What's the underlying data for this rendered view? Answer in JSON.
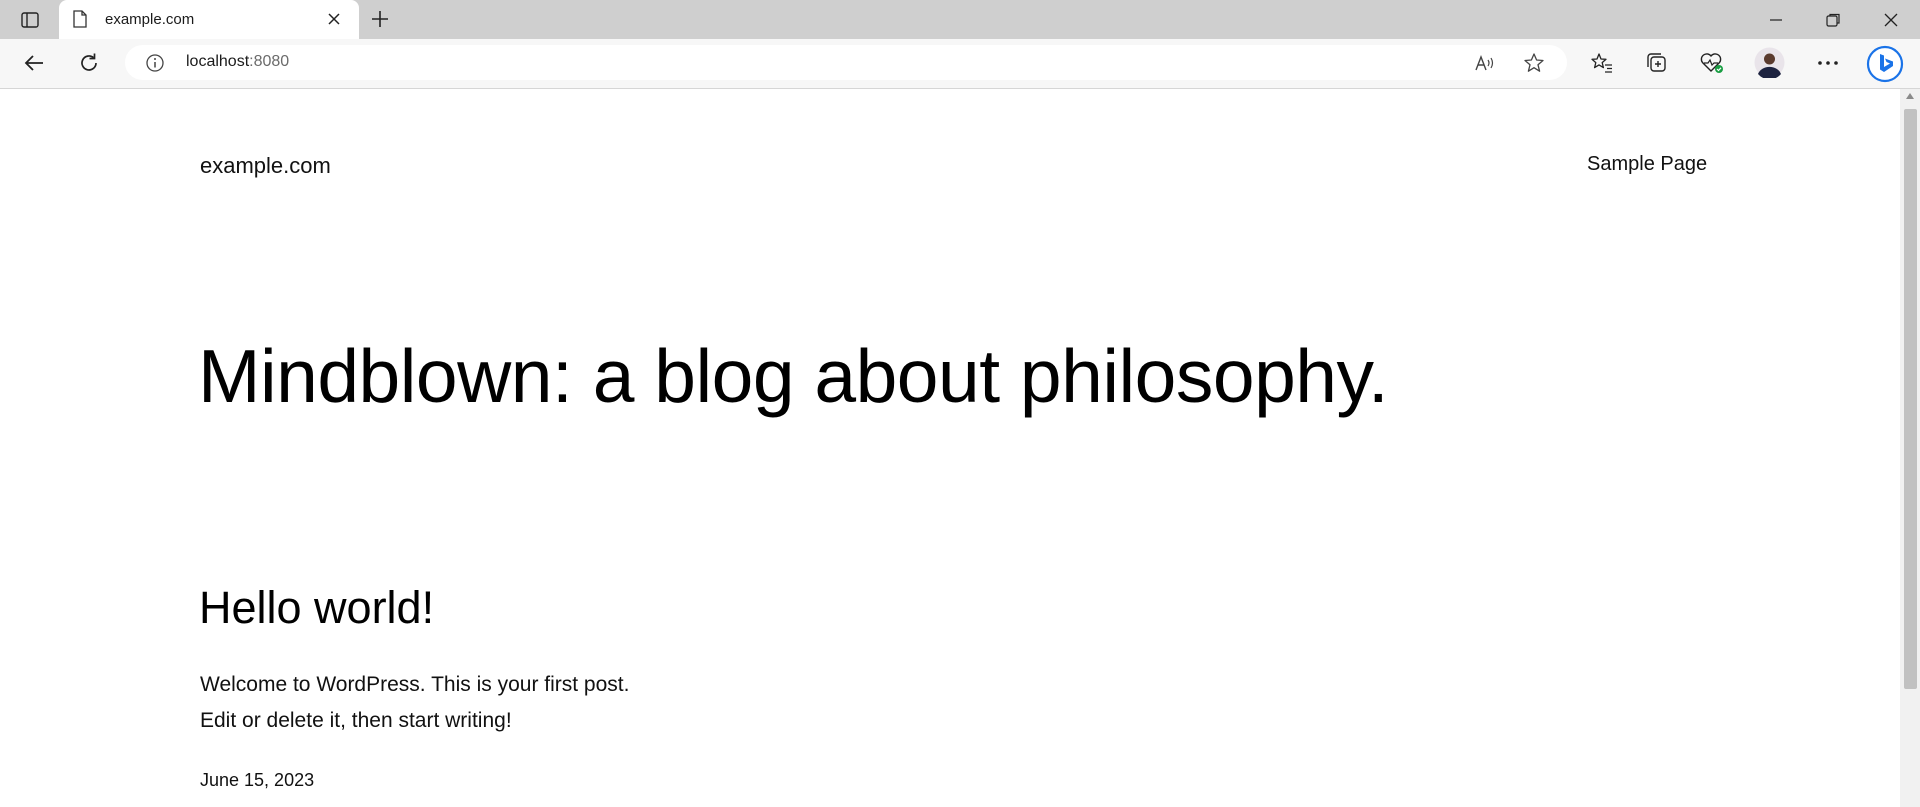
{
  "browser": {
    "tab": {
      "title": "example.com"
    },
    "address": {
      "host": "localhost",
      "port": ":8080"
    }
  },
  "icons": {
    "tab_actions": "tab-actions-icon",
    "favicon": "page-icon",
    "tab_close": "close-icon",
    "new_tab": "plus-icon",
    "back": "arrow-left-icon",
    "reload": "reload-icon",
    "site_info": "info-icon",
    "read_aloud": "read-aloud-icon",
    "favorite": "star-icon",
    "favorites": "favorites-icon",
    "collections": "collections-icon",
    "health": "browser-essentials-icon",
    "profile": "avatar",
    "menu": "more-icon",
    "copilot": "bing-icon"
  },
  "site": {
    "title": "example.com",
    "nav": {
      "sample_page": "Sample Page"
    }
  },
  "main": {
    "heading": "Mindblown: a blog about philosophy.",
    "posts": [
      {
        "title": "Hello world!",
        "excerpt_line1": "Welcome to WordPress. This is your first post.",
        "excerpt_line2": "Edit or delete it, then start writing!",
        "date": "June 15, 2023"
      }
    ]
  },
  "colors": {
    "tabstrip": "#cfcfcf",
    "toolbar": "#f7f7f7",
    "bing_accent": "#1a73e8"
  }
}
